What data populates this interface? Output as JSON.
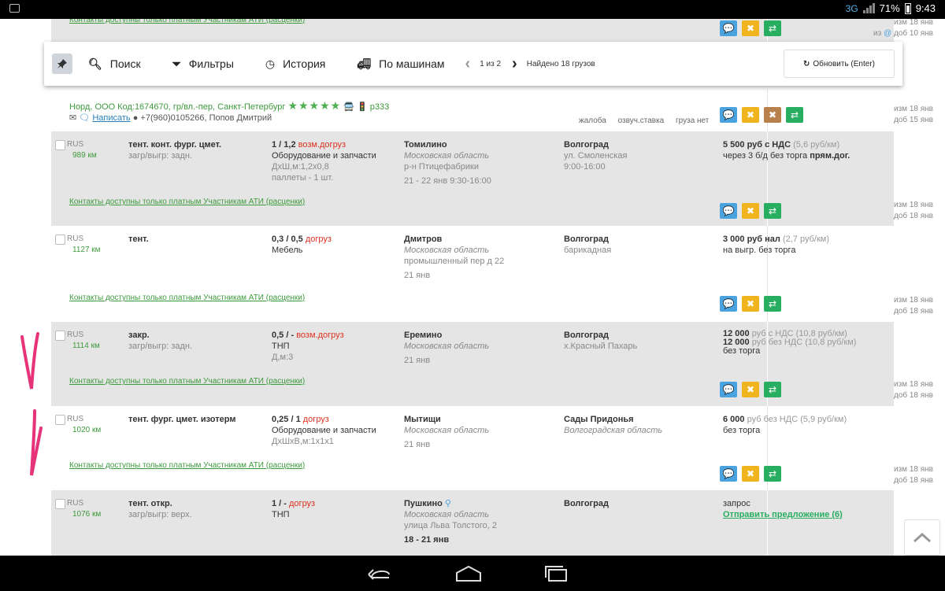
{
  "status": {
    "network": "3G",
    "battery": "71%",
    "time": "9:43"
  },
  "contacts_text": "Контакты доступны только платным Участникам АТИ (расценки)",
  "stamp_changed": "изм 18 янв",
  "stamp_added": "доб 18 янв",
  "top_partial": {
    "changed": "изм 18 янв",
    "added": "доб 10 янв",
    "prefix": "из"
  },
  "toolbar": {
    "search": "Поиск",
    "filters": "Фильтры",
    "history": "История",
    "by_cars": "По машинам",
    "page": "1 из 2",
    "found": "Найдено 18 грузов",
    "refresh": "Обновить (Enter)"
  },
  "company": {
    "name": "Норд, ООО Код:1674670, гр/вл.-пер, Санкт-Петербург",
    "rating": 5,
    "code": "р333",
    "write": "Написать",
    "phone": "+7(960)0105266, Попов Дмитрий",
    "actions": [
      "жалоба",
      "озвуч.ставка",
      "груза нет"
    ],
    "changed": "изм 18 янв",
    "added": "доб 15 янв"
  },
  "listings": [
    {
      "country": "RUS",
      "km": "989 км",
      "type": "тент. конт. фург. цмет.",
      "type_sub": "загр/выгр: задн.",
      "weight": "1 / 1,2",
      "weight_tag": "возм.догруз",
      "cargo": "Оборудование и запчасти",
      "dims": "ДхШ,м:1,2х0,8",
      "pack": "паллеты - 1 шт.",
      "from": "Томилино",
      "from_region": "Московская область",
      "from_addr": "р-н Птицефабрики",
      "from_date": "21 - 22 янв 9:30-16:00",
      "to": "Волгоград",
      "to_addr": "ул. Смоленская",
      "to_time": "9:00-16:00",
      "rate1_main": "5 500",
      "rate1_unit": "руб с НДС",
      "rate1_per": "(5,6 руб/км)",
      "rate_note_a": "через 3 б/д без торга",
      "rate_note_b": "прям.дог.",
      "changed": "изм 18 янв",
      "added": "доб 18 янв"
    },
    {
      "country": "RUS",
      "km": "1127 км",
      "type": "тент.",
      "weight": "0,3 / 0,5",
      "weight_tag": "догруз",
      "cargo": "Мебель",
      "from": "Дмитров",
      "from_region": "Московская область",
      "from_addr": "промышленный пер д 22",
      "from_date": "21 янв",
      "to": "Волгоград",
      "to_addr": "барикадная",
      "rate1_main": "3 000",
      "rate1_unit": "руб нал",
      "rate1_per": "(2,7 руб/км)",
      "rate_note_a": "на выгр. без торга",
      "changed": "изм 18 янв",
      "added": "доб 18 янв"
    },
    {
      "country": "RUS",
      "km": "1114 км",
      "type": "закр.",
      "type_sub": "загр/выгр: задн.",
      "weight": "0,5 / -",
      "weight_tag": "возм.догруз",
      "cargo": "ТНП",
      "dims": "Д,м:3",
      "from": "Еремино",
      "from_region": "Московская область",
      "from_date": "21 янв",
      "to": "Волгоград",
      "to_addr": "х.Красный Пахарь",
      "rate1_main": "12 000",
      "rate1_unit": "руб с НДС",
      "rate1_per": "(10,8 руб/км)",
      "rate2_main": "12 000",
      "rate2_unit": "руб без НДС",
      "rate2_per": "(10,8 руб/км)",
      "rate_note_a": "без торга",
      "changed": "изм 18 янв",
      "added": "доб 18 янв"
    },
    {
      "country": "RUS",
      "km": "1020 км",
      "type": "тент. фург. цмет. изотерм",
      "weight": "0,25 / 1",
      "weight_tag": "догруз",
      "cargo": "Оборудование и запчасти",
      "dims": "ДхШхВ,м:1х1х1",
      "from": "Мытищи",
      "from_region": "Московская область",
      "from_date": "21 янв",
      "to": "Сады Придонья",
      "to_region": "Волгоградская область",
      "rate1_main": "6 000",
      "rate1_unit": "руб без НДС",
      "rate1_per": "(5,9 руб/км)",
      "rate_note_a": "без торга",
      "changed": "изм 18 янв",
      "added": "доб 18 янв"
    },
    {
      "country": "RUS",
      "km": "1076 км",
      "type": "тент. откр.",
      "type_sub": "загр/выгр: верх.",
      "weight": "1 / -",
      "weight_tag": "догруз",
      "cargo": "ТНП",
      "from": "Пушкино",
      "from_region": "Московская область",
      "from_addr": "улица Льва Толстого, 2",
      "from_date": "18 - 21 янв",
      "to": "Волгоград",
      "rate_request": "запрос",
      "offer_link": "Отправить предложение (6)"
    }
  ]
}
